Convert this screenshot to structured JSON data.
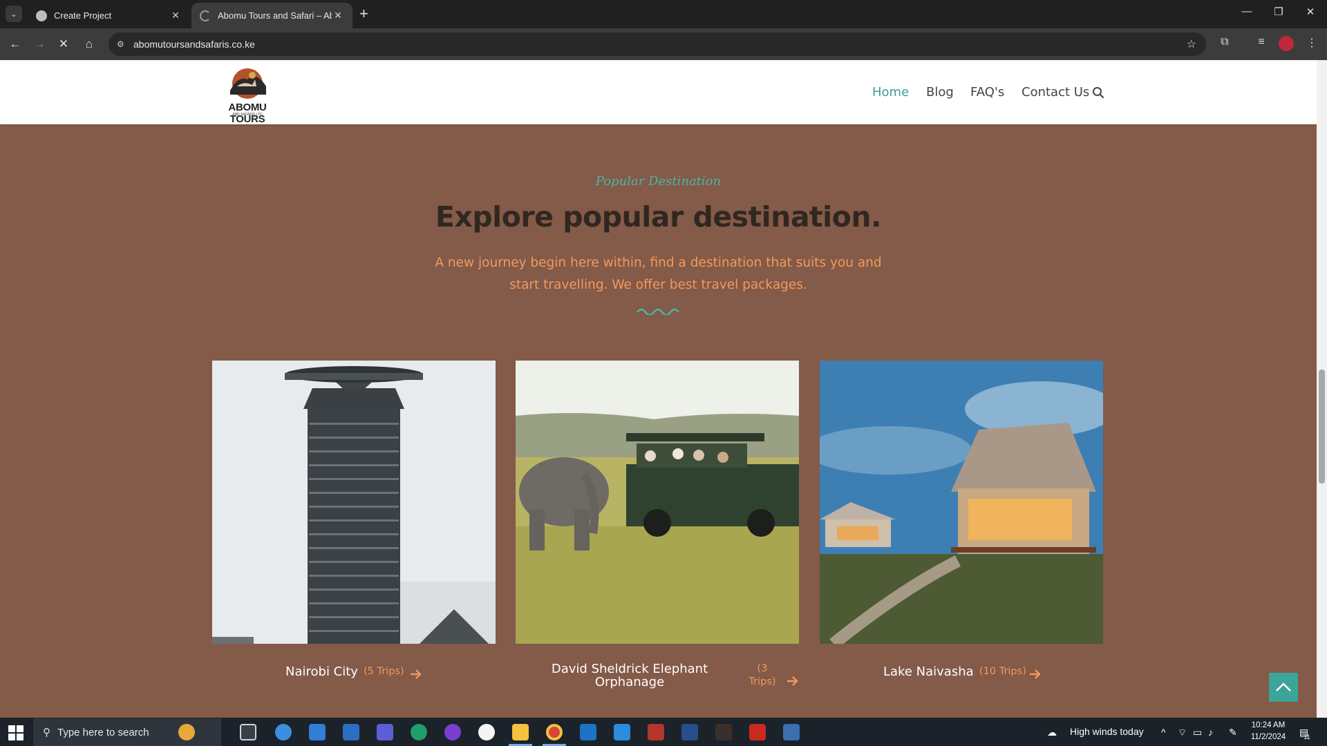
{
  "browser": {
    "tabs": [
      {
        "title": "Create Project",
        "active": false
      },
      {
        "title": "Abomu Tours and Safari – Abom",
        "active": true
      }
    ],
    "url": "abomutoursandsafaris.co.ke"
  },
  "site": {
    "logo_text": "ABOMU TOURS",
    "logo_sub": "AND SAFARIS LTD",
    "nav": [
      {
        "label": "Home",
        "active": true
      },
      {
        "label": "Blog",
        "active": false
      },
      {
        "label": "FAQ's",
        "active": false
      },
      {
        "label": "Contact Us",
        "active": false
      }
    ],
    "section": {
      "subtitle": "Popular Destination",
      "heading": "Explore popular destination.",
      "intro": "A new journey begin here within, find a destination that suits you and start travelling. We offer best travel packages."
    },
    "destinations": [
      {
        "name": "Nairobi City",
        "trips": "(5 Trips)"
      },
      {
        "name": "David Sheldrick Elephant Orphanage",
        "trips": "(3 Trips)"
      },
      {
        "name": "Lake Naivasha",
        "trips": "(10 Trips)"
      }
    ],
    "colors": {
      "accent": "#3f9c93",
      "background": "#845a48",
      "orange": "#f29a5d"
    }
  },
  "taskbar": {
    "search_placeholder": "Type here to search",
    "weather": "High winds today",
    "time": "10:24 AM",
    "date": "11/2/2024",
    "notification_count": "11"
  }
}
